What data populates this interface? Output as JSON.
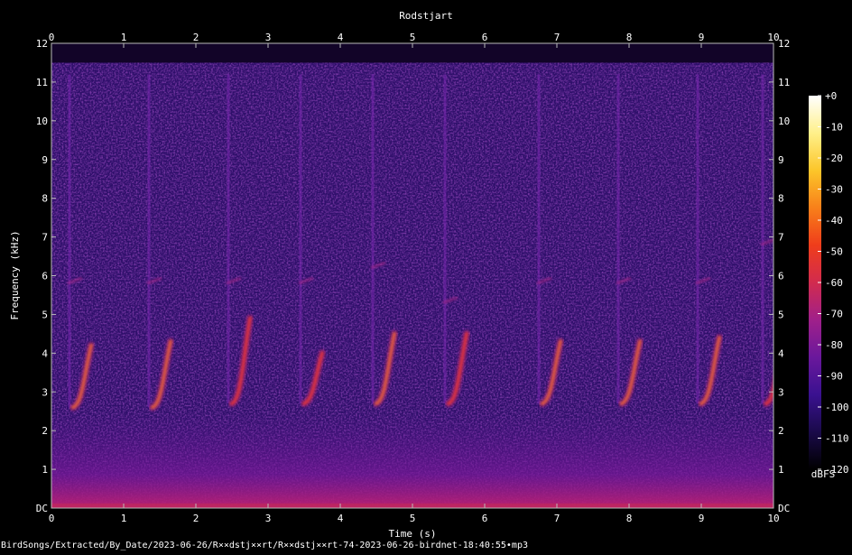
{
  "chart_data": {
    "type": "heatmap",
    "title": "Rodstjart",
    "xlabel": "Time (s)",
    "ylabel": "Frequency (kHz)",
    "xlim": [
      0,
      10
    ],
    "ylim": [
      0,
      12
    ],
    "x_ticks": [
      "0",
      "1",
      "2",
      "3",
      "4",
      "5",
      "6",
      "7",
      "8",
      "9",
      "10"
    ],
    "y_ticks": [
      "DC",
      "1",
      "2",
      "3",
      "4",
      "5",
      "6",
      "7",
      "8",
      "9",
      "10",
      "11",
      "12"
    ],
    "colorbar": {
      "label": "dBFS",
      "range": [
        -120,
        0
      ],
      "ticks": [
        "+0",
        "-10",
        "-20",
        "-30",
        "-40",
        "-50",
        "-60",
        "-70",
        "-80",
        "-90",
        "-100",
        "-110",
        "-120"
      ],
      "colors": [
        "#000000",
        "#1a0a4a",
        "#3a1190",
        "#6a189c",
        "#a0208a",
        "#d22b4e",
        "#ef3d1b",
        "#f8801a",
        "#fcc62a",
        "#fff08a",
        "#ffffff"
      ]
    },
    "noise_colors": {
      "background": "#2e0f6a",
      "low_band": "#5a1590",
      "top_band": "#120428"
    },
    "song_phrases": [
      {
        "t": 0.3,
        "freq_range": [
          2.6,
          4.2
        ],
        "peak_kHz": 4.8,
        "level_dB": -40
      },
      {
        "t": 1.4,
        "freq_range": [
          2.6,
          4.3
        ],
        "peak_kHz": 4.8,
        "level_dB": -40
      },
      {
        "t": 2.5,
        "freq_range": [
          2.7,
          4.9
        ],
        "peak_kHz": 4.8,
        "level_dB": -45
      },
      {
        "t": 3.5,
        "freq_range": [
          2.7,
          4.0
        ],
        "peak_kHz": 4.8,
        "level_dB": -45
      },
      {
        "t": 4.5,
        "freq_range": [
          2.7,
          4.5
        ],
        "peak_kHz": 5.2,
        "level_dB": -40
      },
      {
        "t": 5.5,
        "freq_range": [
          2.7,
          4.5
        ],
        "peak_kHz": 4.3,
        "level_dB": -50
      },
      {
        "t": 6.8,
        "freq_range": [
          2.7,
          4.3
        ],
        "peak_kHz": 4.8,
        "level_dB": -40
      },
      {
        "t": 7.9,
        "freq_range": [
          2.7,
          4.3
        ],
        "peak_kHz": 4.8,
        "level_dB": -40
      },
      {
        "t": 9.0,
        "freq_range": [
          2.7,
          4.4
        ],
        "peak_kHz": 4.8,
        "level_dB": -40
      },
      {
        "t": 9.9,
        "freq_range": [
          2.7,
          4.6
        ],
        "peak_kHz": 5.8,
        "level_dB": -45
      }
    ]
  },
  "footer_path": "BirdSongs/Extracted/By_Date/2023-06-26/R××dstj××rt/R××dstj××rt-74-2023-06-26-birdnet-18:40:55•mp3"
}
